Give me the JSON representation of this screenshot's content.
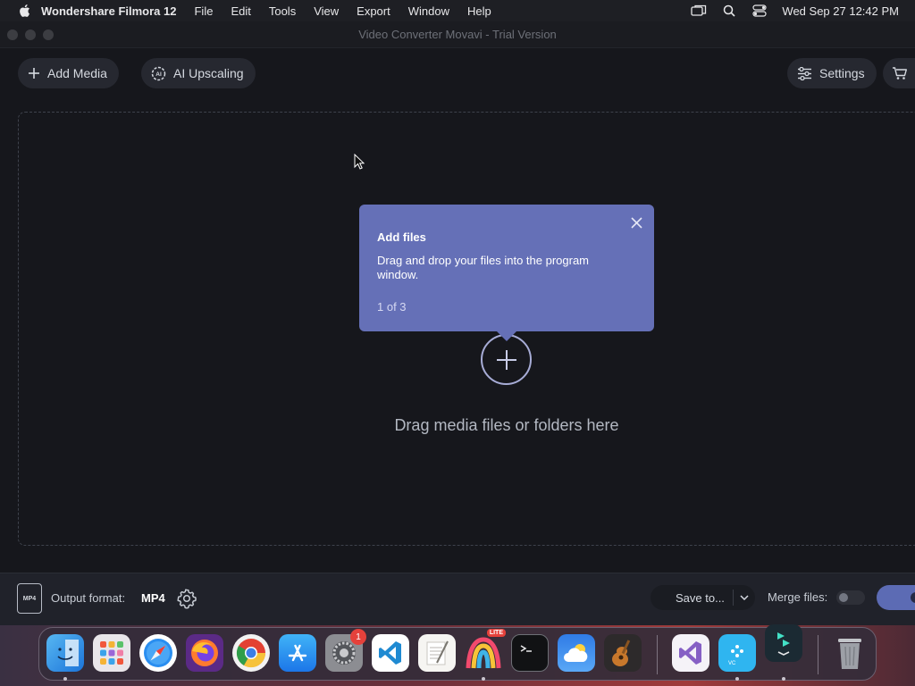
{
  "menubar": {
    "app_name": "Wondershare Filmora 12",
    "items": [
      "File",
      "Edit",
      "Tools",
      "View",
      "Export",
      "Window",
      "Help"
    ],
    "clock": "Wed Sep 27  12:42 PM"
  },
  "window": {
    "title": "Video Converter Movavi - Trial Version"
  },
  "toolbar": {
    "add_media": "Add Media",
    "ai_upscaling": "AI Upscaling",
    "settings": "Settings"
  },
  "dropzone": {
    "text": "Drag media files or folders here"
  },
  "tooltip": {
    "title": "Add files",
    "body": "Drag and drop your files into the program window.",
    "step": "1 of 3",
    "color": "#6570b7"
  },
  "bottombar": {
    "format_icon_label": "MP4",
    "output_label": "Output format:",
    "output_value": "MP4",
    "save_to": "Save to...",
    "merge_label": "Merge files:"
  },
  "dock": {
    "apps": [
      "finder-icon",
      "launchpad-icon",
      "safari-icon",
      "firefox-icon",
      "chrome-icon",
      "app-store-icon",
      "system-settings-icon",
      "vscode-icon",
      "textedit-icon",
      "pixelmator-icon",
      "terminal-icon",
      "weather-icon",
      "garageband-icon",
      "visual-studio-icon",
      "vc-app-icon",
      "filmora-icon",
      "trash-icon"
    ],
    "settings_badge": "1",
    "pixelmator_badge": "LITE"
  }
}
